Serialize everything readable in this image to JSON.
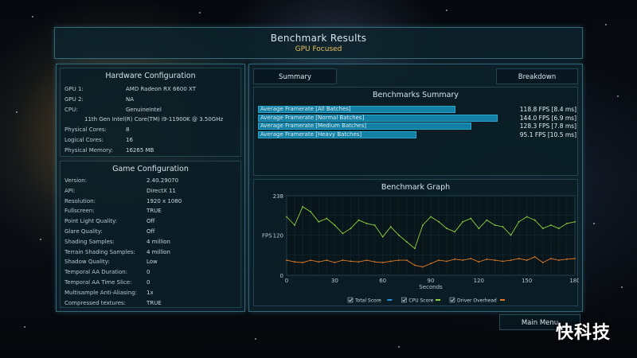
{
  "header": {
    "title": "Benchmark Results",
    "subtitle": "GPU Focused"
  },
  "hardware": {
    "title": "Hardware Configuration",
    "rows": [
      {
        "label": "GPU 1:",
        "value": "AMD Radeon RX 6600 XT"
      },
      {
        "label": "GPU 2:",
        "value": "NA"
      },
      {
        "label": "CPU:",
        "value": "GenuineIntel"
      },
      {
        "label": "",
        "value": "11th Gen Intel(R) Core(TM) i9-11900K @ 3.50GHz"
      },
      {
        "label": "Physical Cores:",
        "value": "8"
      },
      {
        "label": "Logical Cores:",
        "value": "16"
      },
      {
        "label": "Physical Memory:",
        "value": "16265  MB"
      }
    ]
  },
  "game": {
    "title": "Game Configuration",
    "rows": [
      {
        "label": "Version:",
        "value": "2.40.29070"
      },
      {
        "label": "API:",
        "value": "DirectX 11"
      },
      {
        "label": "Resolution:",
        "value": "1920 x 1080"
      },
      {
        "label": "Fullscreen:",
        "value": "TRUE"
      },
      {
        "label": "Point Light Quality:",
        "value": "Off"
      },
      {
        "label": "Glare Quality:",
        "value": "Off"
      },
      {
        "label": "Shading Samples:",
        "value": "4 million"
      },
      {
        "label": "Terrain Shading Samples:",
        "value": "4 million"
      },
      {
        "label": "Shadow Quality:",
        "value": "Low"
      },
      {
        "label": "Temporal AA Duration:",
        "value": "0"
      },
      {
        "label": "Temporal AA Time Slice:",
        "value": "0"
      },
      {
        "label": "Multisample Anti-Aliasing:",
        "value": "1x"
      },
      {
        "label": "Compressed textures:",
        "value": "TRUE"
      }
    ]
  },
  "tabs": {
    "summary": "Summary",
    "breakdown": "Breakdown"
  },
  "summary": {
    "title": "Benchmarks Summary",
    "max_fps": 158,
    "bars": [
      {
        "label": "Average Framerate [All Batches]",
        "fps": 118.8,
        "value": "118.8 FPS [8.4 ms]"
      },
      {
        "label": "Average Framerate [Normal Batches]",
        "fps": 144.0,
        "value": "144.0 FPS [6.9 ms]"
      },
      {
        "label": "Average Framerate [Medium Batches]",
        "fps": 128.3,
        "value": "128.3 FPS [7.8 ms]"
      },
      {
        "label": "Average Framerate [Heavy Batches]",
        "fps": 95.1,
        "value": "95.1 FPS [10.5 ms]"
      }
    ]
  },
  "graph": {
    "title": "Benchmark Graph",
    "y_label": "FPS",
    "x_label": "Seconds",
    "y_ticks": [
      "238",
      "120",
      "0"
    ],
    "x_ticks": [
      "0",
      "30",
      "60",
      "90",
      "120",
      "150",
      "180"
    ],
    "legend": [
      {
        "label": "Total Score",
        "color": "#2b8fd6"
      },
      {
        "label": "CPU Score",
        "color": "#8fd13a"
      },
      {
        "label": "Driver Overhead",
        "color": "#e07a26"
      }
    ]
  },
  "chart_data": {
    "type": "line",
    "title": "Benchmark Graph",
    "xlabel": "Seconds",
    "ylabel": "FPS",
    "xlim": [
      0,
      180
    ],
    "ylim": [
      0,
      238
    ],
    "grid": true,
    "legend_position": "bottom",
    "x": [
      0,
      5,
      10,
      15,
      20,
      25,
      30,
      35,
      40,
      45,
      50,
      55,
      60,
      65,
      70,
      75,
      80,
      85,
      90,
      95,
      100,
      105,
      110,
      115,
      120,
      125,
      130,
      135,
      140,
      145,
      150,
      155,
      160,
      165,
      170,
      175,
      180
    ],
    "series": [
      {
        "name": "CPU Score",
        "values": [
          175,
          150,
          205,
          190,
          160,
          170,
          150,
          125,
          140,
          165,
          155,
          150,
          115,
          145,
          120,
          100,
          80,
          150,
          175,
          160,
          140,
          130,
          160,
          170,
          140,
          165,
          150,
          145,
          120,
          160,
          175,
          165,
          140,
          150,
          140,
          155,
          160
        ]
      },
      {
        "name": "Driver Overhead",
        "values": [
          45,
          40,
          38,
          45,
          40,
          45,
          38,
          45,
          42,
          40,
          45,
          40,
          38,
          42,
          45,
          45,
          30,
          25,
          35,
          45,
          42,
          48,
          45,
          50,
          40,
          48,
          45,
          42,
          45,
          50,
          45,
          55,
          38,
          50,
          45,
          48,
          50
        ]
      }
    ]
  },
  "main_menu": "Main Menu",
  "watermark": "快科技"
}
